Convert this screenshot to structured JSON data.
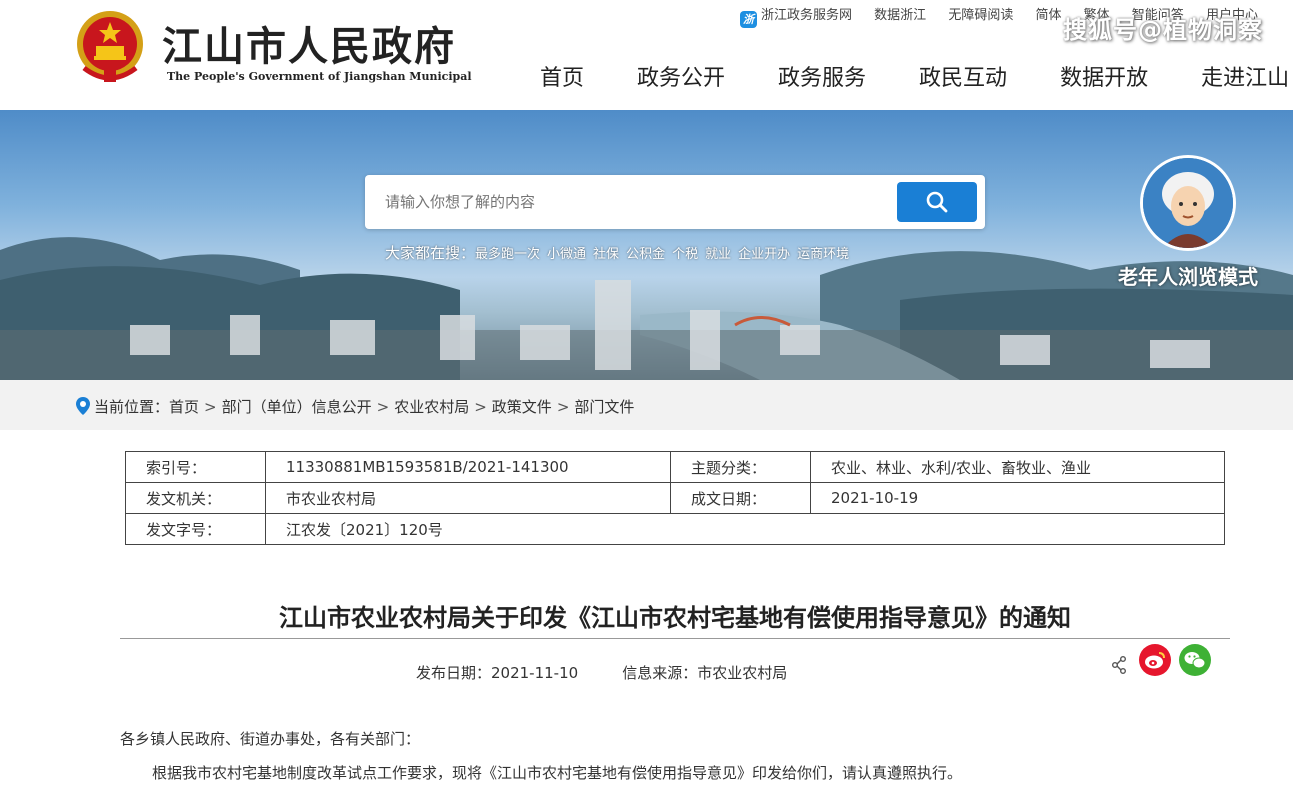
{
  "header": {
    "title": "江山市人民政府",
    "subtitle": "The People's Government of Jiangshan Municipal",
    "top_links": [
      "浙江政务服务网",
      "数据浙江",
      "无障碍阅读",
      "简体",
      "繁体",
      "智能问答",
      "用户中心"
    ],
    "watermark": "搜狐号@植物洞察",
    "nav": [
      "首页",
      "政务公开",
      "政务服务",
      "政民互动",
      "数据开放",
      "走进江山"
    ]
  },
  "search": {
    "placeholder": "请输入你想了解的内容",
    "hot_label": "大家都在搜：",
    "hot_keywords": [
      "最多跑一次",
      "小微通",
      "社保",
      "公积金",
      "个税",
      "就业",
      "企业开办",
      "运商环境"
    ]
  },
  "elder_mode": {
    "label": "老年人浏览模式"
  },
  "breadcrumb": {
    "prefix": "当前位置：",
    "items": [
      "首页",
      "部门（单位）信息公开",
      "农业农村局",
      "政策文件",
      "部门文件"
    ]
  },
  "meta": {
    "index_label": "索引号：",
    "index_value": "11330881MB1593581B/2021-141300",
    "topic_label": "主题分类：",
    "topic_value": "农业、林业、水利/农业、畜牧业、渔业",
    "issuer_label": "发文机关：",
    "issuer_value": "市农业农村局",
    "date_label": "成文日期：",
    "date_value": "2021-10-19",
    "docno_label": "发文字号：",
    "docno_value": "江农发〔2021〕120号"
  },
  "article": {
    "title": "江山市农业农村局关于印发《江山市农村宅基地有偿使用指导意见》的通知",
    "pub_date": "发布日期：2021-11-10",
    "source": "信息来源：市农业农村局",
    "para1": "各乡镇人民政府、街道办事处，各有关部门：",
    "para2": "根据我市农村宅基地制度改革试点工作要求，现将《江山市农村宅基地有偿使用指导意见》印发给你们，请认真遵照执行。"
  },
  "colors": {
    "accent": "#1a7fd5",
    "weibo": "#e6162d",
    "wechat": "#3eb135"
  }
}
